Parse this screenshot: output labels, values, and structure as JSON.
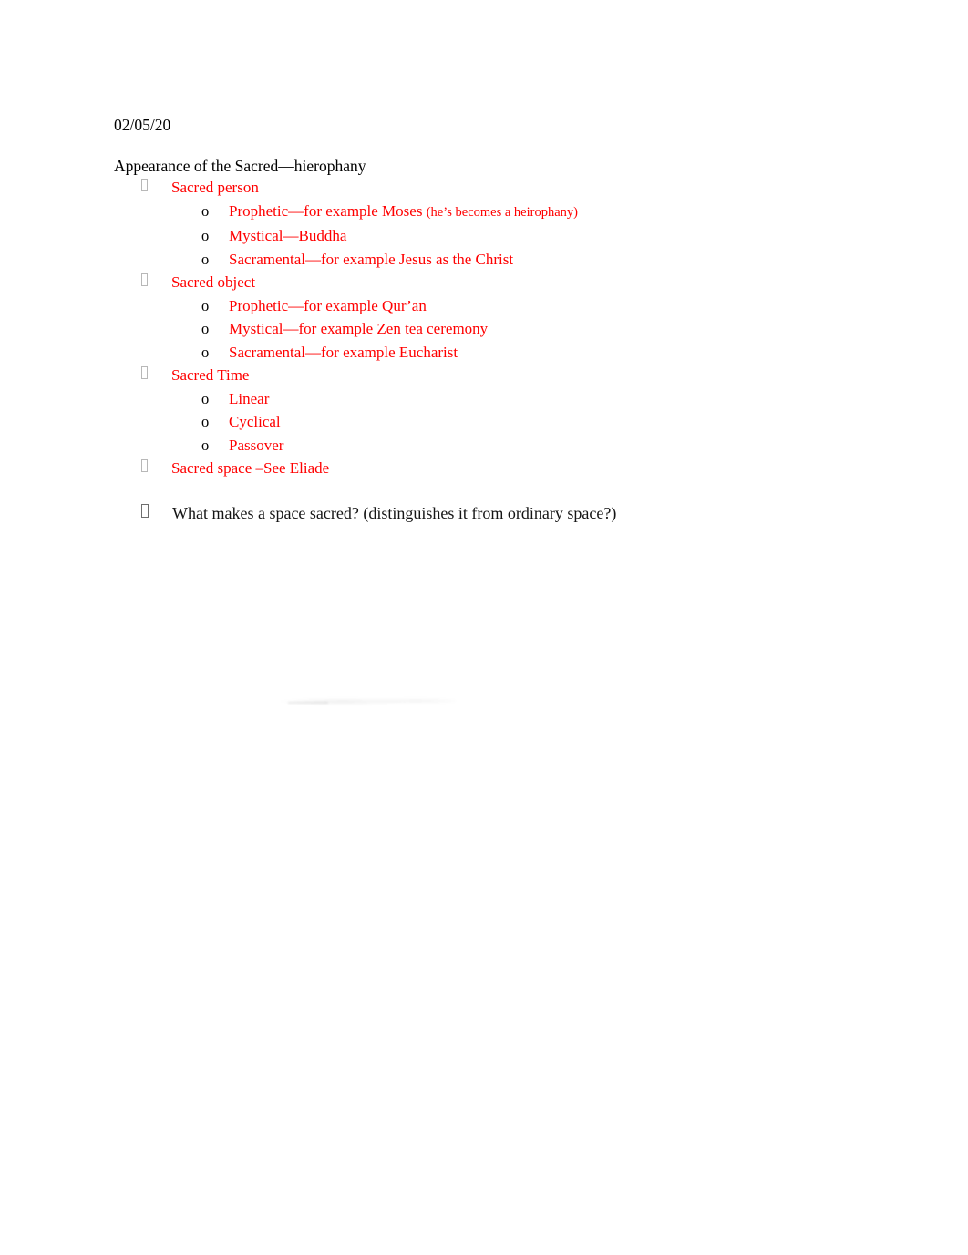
{
  "document": {
    "date": "02/05/20",
    "title": "Appearance of the Sacred—hierophany",
    "outline": [
      {
        "marker": "tofu-bullet",
        "text": "Sacred person",
        "color": "#ff0000",
        "children": [
          {
            "marker": "o",
            "text": "Prophetic—for example Moses ",
            "note": "(he’s becomes a heirophany)",
            "color": "#ff0000"
          },
          {
            "marker": "o",
            "text": "Mystical—Buddha",
            "color": "#ff0000"
          },
          {
            "marker": "o",
            "text": "Sacramental—for example Jesus as the Christ",
            "color": "#ff0000"
          }
        ]
      },
      {
        "marker": "tofu-bullet",
        "text": "Sacred object",
        "color": "#ff0000",
        "children": [
          {
            "marker": "o",
            "text": "Prophetic—for example Qur’an",
            "color": "#ff0000"
          },
          {
            "marker": "o",
            "text": "Mystical—for example Zen tea ceremony",
            "color": "#ff0000"
          },
          {
            "marker": "o",
            "text": "Sacramental—for example Eucharist",
            "color": "#ff0000"
          }
        ]
      },
      {
        "marker": "tofu-bullet",
        "text": "Sacred Time",
        "color": "#ff0000",
        "children": [
          {
            "marker": "o",
            "text": "Linear",
            "color": "#ff0000"
          },
          {
            "marker": "o",
            "text": "Cyclical",
            "color": "#ff0000"
          },
          {
            "marker": "o",
            "text": "Passover",
            "color": "#ff0000"
          }
        ]
      },
      {
        "marker": "tofu-bullet",
        "text": "Sacred space –See Eliade",
        "color": "#ff0000",
        "children": []
      },
      {
        "marker": "tofu-bullet",
        "text": "What makes a space sacred? (distinguishes it from ordinary space?)",
        "color": "#151515",
        "children": []
      }
    ]
  },
  "colors": {
    "page_background": "#ffffff",
    "body_text": "#000000",
    "highlight_red": "#ff0000",
    "bullet_glyph_gray": "#b8b8b8"
  }
}
